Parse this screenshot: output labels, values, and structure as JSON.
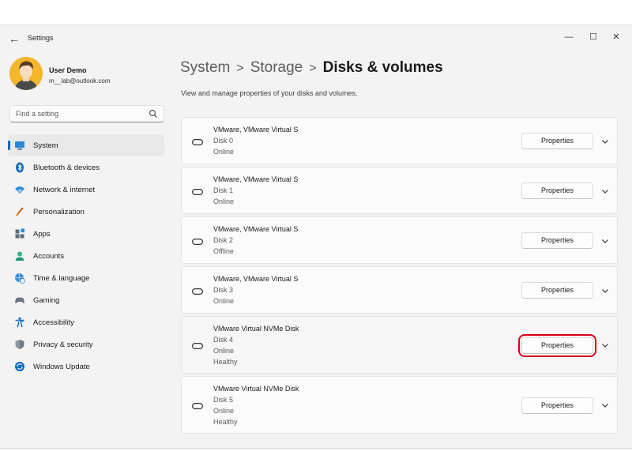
{
  "window": {
    "title": "Settings",
    "controls": {
      "minimize": "—",
      "maximize": "☐",
      "close": "✕"
    }
  },
  "user": {
    "name": "User Demo",
    "email": "m__lab@outlook.com"
  },
  "search": {
    "placeholder": "Find a setting"
  },
  "nav": {
    "items": [
      {
        "label": "System",
        "icon": "system-icon",
        "active": true
      },
      {
        "label": "Bluetooth & devices",
        "icon": "bluetooth-icon"
      },
      {
        "label": "Network & internet",
        "icon": "wifi-icon"
      },
      {
        "label": "Personalization",
        "icon": "brush-icon"
      },
      {
        "label": "Apps",
        "icon": "apps-icon"
      },
      {
        "label": "Accounts",
        "icon": "accounts-icon"
      },
      {
        "label": "Time & language",
        "icon": "globe-clock-icon"
      },
      {
        "label": "Gaming",
        "icon": "gamepad-icon"
      },
      {
        "label": "Accessibility",
        "icon": "accessibility-icon"
      },
      {
        "label": "Privacy & security",
        "icon": "shield-icon"
      },
      {
        "label": "Windows Update",
        "icon": "update-icon"
      }
    ]
  },
  "breadcrumb": {
    "items": [
      "System",
      "Storage"
    ],
    "separator": ">",
    "current": "Disks & volumes"
  },
  "page": {
    "description": "View and manage properties of your disks and volumes."
  },
  "disks": [
    {
      "name": "VMware, VMware Virtual S",
      "disk": "Disk 0",
      "status": "Online",
      "health": "",
      "button": "Properties"
    },
    {
      "name": "VMware, VMware Virtual S",
      "disk": "Disk 1",
      "status": "Online",
      "health": "",
      "button": "Properties"
    },
    {
      "name": "VMware, VMware Virtual S",
      "disk": "Disk 2",
      "status": "Offline",
      "health": "",
      "button": "Properties"
    },
    {
      "name": "VMware, VMware Virtual S",
      "disk": "Disk 3",
      "status": "Online",
      "health": "",
      "button": "Properties"
    },
    {
      "name": "VMware Virtual NVMe Disk",
      "disk": "Disk 4",
      "status": "Online",
      "health": "Healthy",
      "button": "Properties",
      "highlighted": true
    },
    {
      "name": "VMware Virtual NVMe Disk",
      "disk": "Disk 5",
      "status": "Online",
      "health": "Healthy",
      "button": "Properties"
    }
  ],
  "colors": {
    "accent": "#0067c0",
    "highlight_box": "#d9001b",
    "window_bg": "#f3f3f3",
    "card_bg": "#fbfbfb"
  }
}
